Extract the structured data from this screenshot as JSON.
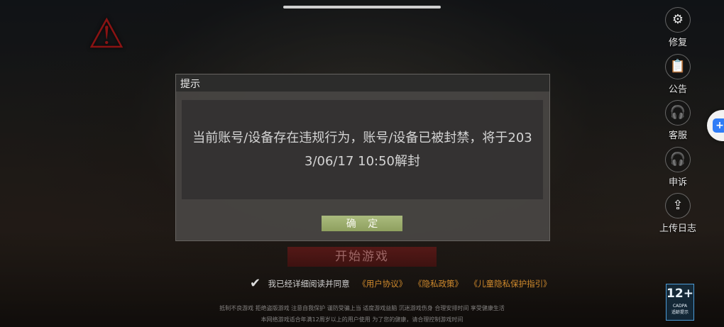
{
  "sidebar": {
    "items": [
      {
        "label": "修复",
        "icon": "gear-icon"
      },
      {
        "label": "公告",
        "icon": "clipboard-icon"
      },
      {
        "label": "客服",
        "icon": "headset-icon"
      },
      {
        "label": "申诉",
        "icon": "headset-icon"
      },
      {
        "label": "上传日志",
        "icon": "upload-icon"
      }
    ]
  },
  "dialog": {
    "title": "提示",
    "message_line1": "当前账号/设备存在违规行为，账号/设备已被封禁，将于203",
    "message_line2": "3/06/17 10:50解封",
    "confirm_label": "确 定"
  },
  "main": {
    "start_button": "开始游戏",
    "agreement_text": "我已经详细阅读并同意",
    "links": [
      "《用户协议》",
      "《隐私政策》",
      "《儿童隐私保护指引》"
    ],
    "notice_line1": "抵制不良游戏  拒绝盗版游戏  注意自我保护  谨防受骗上当  适度游戏益脑  沉迷游戏伤身  合理安排时间  享受健康生活",
    "notice_line2": "本网络游戏适合年满12周岁以上的用户使用   为了您的健康，请合理控制游戏时间"
  },
  "age_rating": {
    "number": "12+",
    "label": "CADPA",
    "sub": "适龄提示"
  },
  "colors": {
    "link": "#d08a2c",
    "confirm_button": "#9fb06c",
    "logo": "#8a1313"
  }
}
